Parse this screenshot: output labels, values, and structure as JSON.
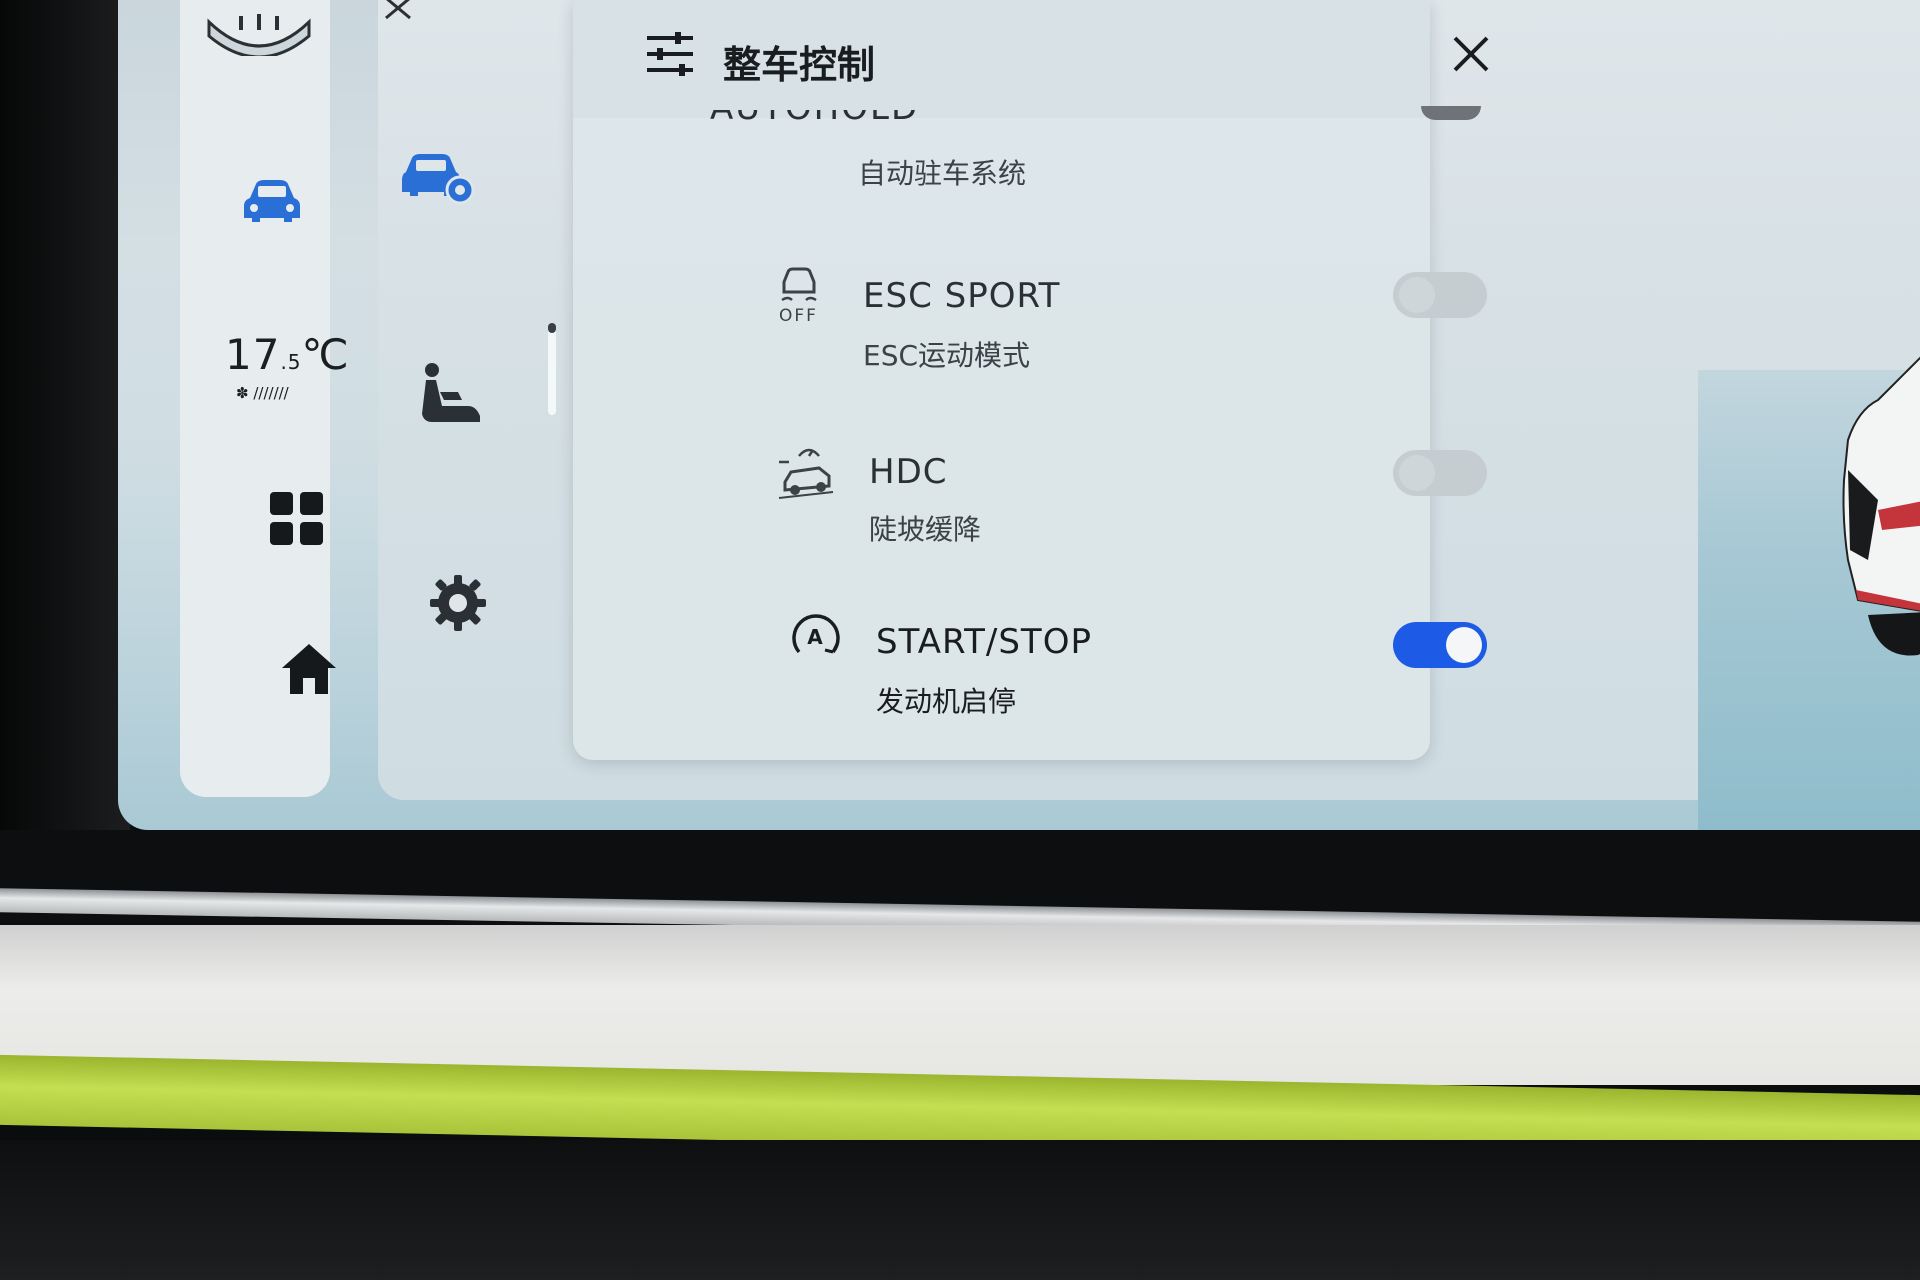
{
  "climate": {
    "temp_main": "17",
    "temp_decimal": ".5",
    "temp_unit": "℃",
    "fan_level": "///////"
  },
  "dialog": {
    "title": "整车控制",
    "rows": [
      {
        "title": "AUTOHOLD",
        "subtitle": "自动驻车系统",
        "toggle": "off"
      },
      {
        "title": "ESC SPORT",
        "subtitle": "ESC运动模式",
        "icon_caption": "OFF",
        "toggle": "off"
      },
      {
        "title": "HDC",
        "subtitle": "陡坡缓降",
        "toggle": "off"
      },
      {
        "title": "START/STOP",
        "subtitle": "发动机启停",
        "toggle": "on"
      }
    ]
  },
  "colors": {
    "accent": "#1d5be6",
    "nav_active": "#2a6fd6",
    "toggle_off": "#c5cdd1"
  },
  "icons": {
    "left_nav": [
      "mirror-icon",
      "car-icon",
      "apps-grid-icon",
      "home-icon"
    ],
    "mid_nav": [
      "car-settings-icon",
      "seat-icon",
      "gear-icon"
    ],
    "dialog": [
      "sliders-icon",
      "close-icon",
      "esc-off-icon",
      "hdc-icon",
      "auto-start-stop-icon"
    ]
  }
}
